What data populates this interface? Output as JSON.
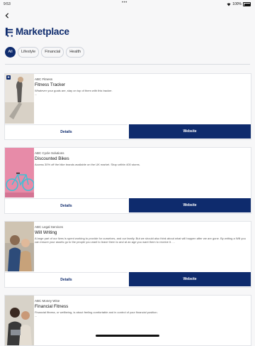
{
  "status_bar": {
    "time": "9:53",
    "dots": "•••",
    "battery": "100%"
  },
  "header": {
    "title": "Marketplace"
  },
  "filters": [
    {
      "label": "All",
      "active": true
    },
    {
      "label": "Lifestyle",
      "active": false
    },
    {
      "label": "Financial",
      "active": false
    },
    {
      "label": "Health",
      "active": false
    }
  ],
  "cards": [
    {
      "provider": "ABC Fitness",
      "title": "Fitness Tracker",
      "description": "Whatever your goals are, stay on top of them with this tracker.",
      "extra": "...",
      "details_label": "Details",
      "website_label": "Website"
    },
    {
      "provider": "ABC Cycle Solutions",
      "title": "Discounted Bikes",
      "description": "Access 30% off the bike brands available on the UK market. Shop within 400 stores.",
      "extra": "",
      "details_label": "Details",
      "website_label": "Website"
    },
    {
      "provider": "ABC Legal Services",
      "title": "Will Writing",
      "description": "A large part of our lives is spent working to provide for ourselves, and our family. But we should also think about what will happen after we are gone. By writing a Will you can ensure your assets go to the people you want to leave them to and at an age you want them to receive it. ...",
      "extra": "",
      "details_label": "Details",
      "website_label": "Website"
    },
    {
      "provider": "ABC Money Wise",
      "title": "Financial Fitness",
      "description": "Financial fitness, or wellbeing, is about feeling comfortable and in control of your financial position.",
      "extra": "...",
      "details_label": "Details",
      "website_label": "Website"
    }
  ],
  "colors": {
    "brand": "#0e2b6d",
    "background": "#f7f7f8"
  }
}
